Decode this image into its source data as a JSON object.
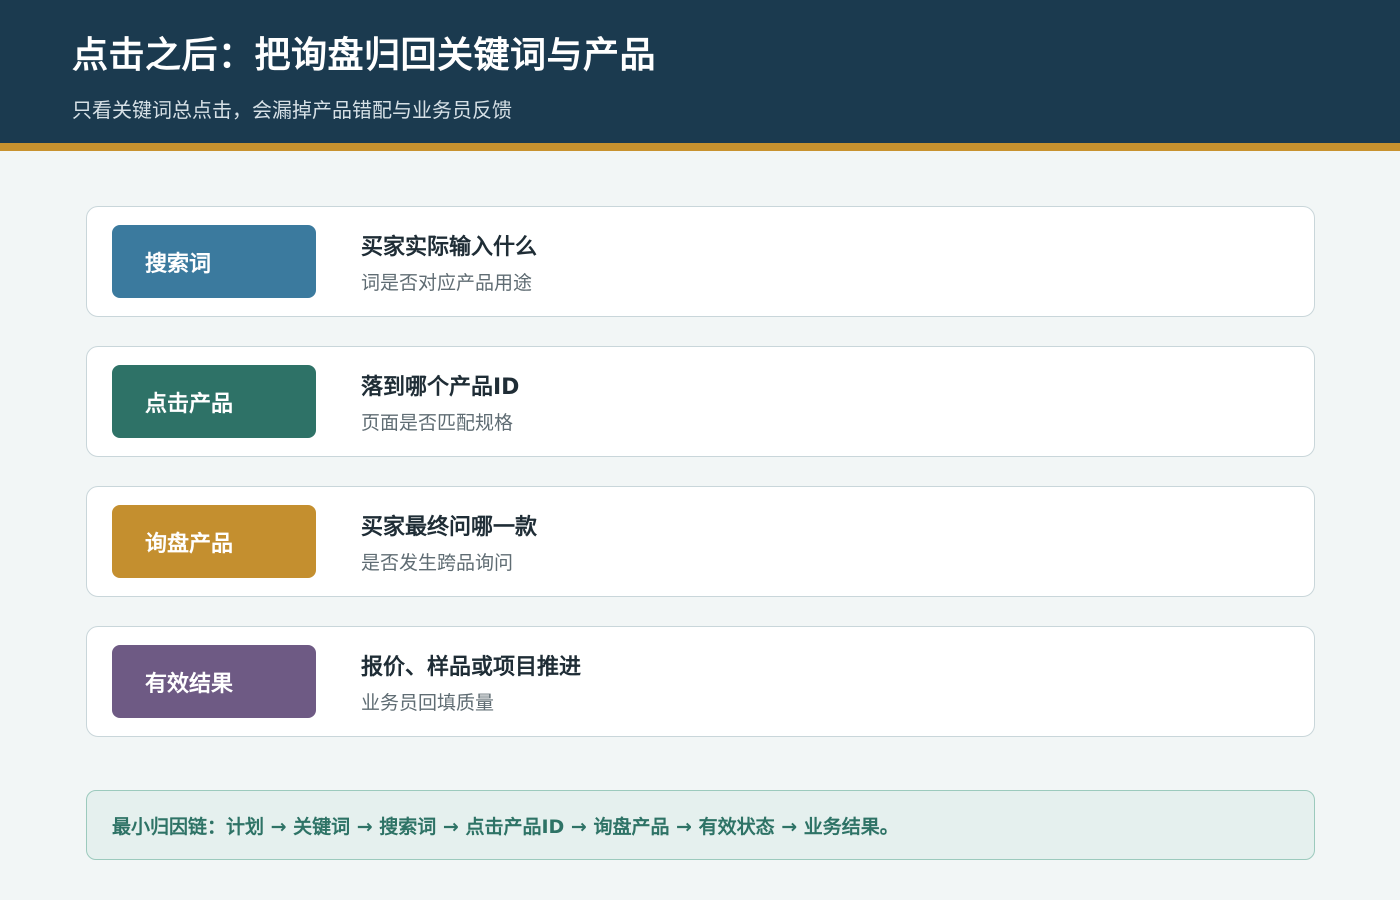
{
  "header": {
    "title": "点击之后：把询盘归回关键词与产品",
    "subtitle": "只看关键词总点击，会漏掉产品错配与业务员反馈"
  },
  "rows": [
    {
      "tag": "搜索词",
      "title": "买家实际输入什么",
      "desc": "词是否对应产品用途",
      "color": "#3b7a9e"
    },
    {
      "tag": "点击产品",
      "title": "落到哪个产品ID",
      "desc": "页面是否匹配规格",
      "color": "#2e7267"
    },
    {
      "tag": "询盘产品",
      "title": "买家最终问哪一款",
      "desc": "是否发生跨品询问",
      "color": "#c48f2f"
    },
    {
      "tag": "有效结果",
      "title": "报价、样品或项目推进",
      "desc": "业务员回填质量",
      "color": "#6e5a84"
    }
  ],
  "footer": {
    "chain": "最小归因链：计划 → 关键词 → 搜索词 → 点击产品ID → 询盘产品 → 有效状态 → 业务结果。"
  },
  "colors": {
    "header_bg": "#1b3a4f",
    "accent": "#c8922f",
    "page_bg": "#f2f6f6"
  }
}
